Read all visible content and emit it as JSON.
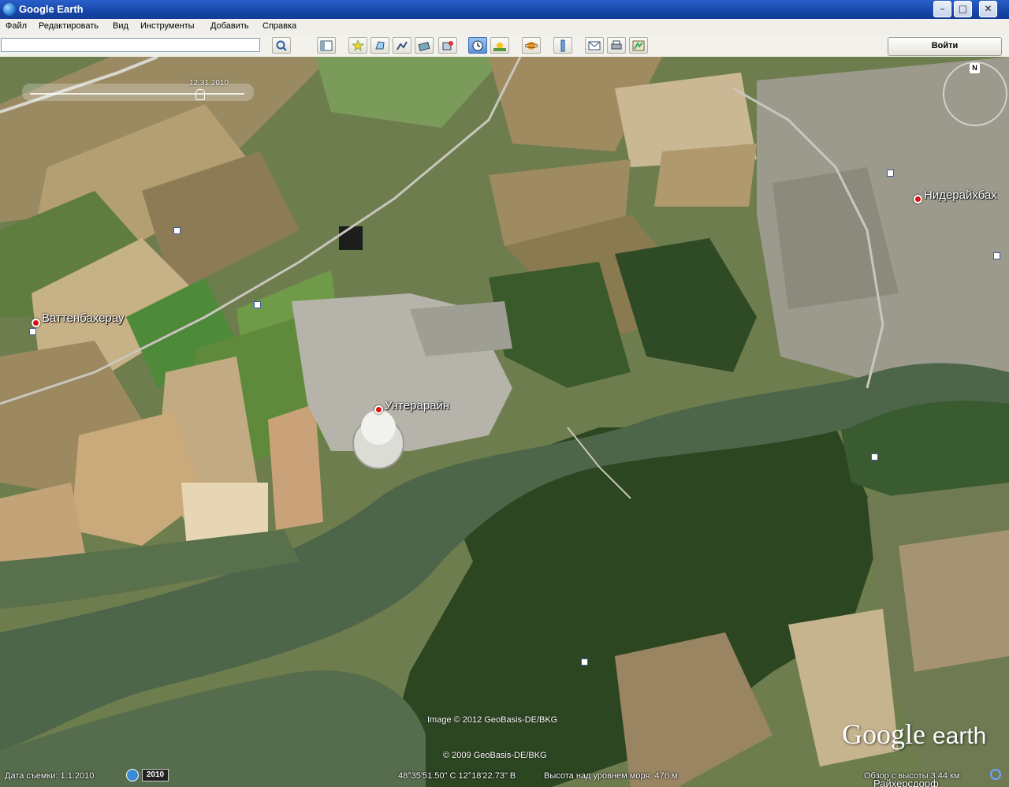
{
  "window": {
    "title": "Google Earth"
  },
  "menu": [
    "Файл",
    "Редактировать",
    "Вид",
    "Инструменты",
    "Добавить",
    "Справка"
  ],
  "search": {
    "value": "",
    "placeholder": ""
  },
  "toolbar": {
    "buttons": [
      "search-icon",
      "sidebar-icon",
      "placemark-icon",
      "polygon-icon",
      "path-icon",
      "overlay-icon",
      "record-tour-icon",
      "historical-imagery-icon",
      "sunlight-icon",
      "planets-icon",
      "ruler-icon",
      "email-icon",
      "print-icon",
      "view-in-maps-icon"
    ],
    "signin_label": "Войти"
  },
  "map": {
    "time_slider_date": "12.31.2010",
    "compass_north": "N",
    "places": [
      {
        "name": "Ваттенбахерау"
      },
      {
        "name": "Унтерарайн"
      },
      {
        "name": "Нидерайхбах"
      }
    ],
    "attribution_1": "Image © 2012 GeoBasis-DE/BKG",
    "attribution_2": "© 2009 GeoBasis-DE/BKG",
    "logo_google": "Google",
    "logo_earth": "earth"
  },
  "status": {
    "imagery_date": "Дата съемки: 1.1.2010",
    "year_badge": "2010",
    "coordinates": "48°35'51.50\" С   12°18'22.73\" В",
    "elevation": "Высота над уровнем моря:   476 м",
    "eye_alt": "Обзор с высоты    3.44 км",
    "bottom_town": "Райхерсдорф"
  },
  "colors": {
    "titlebar": "#1746a8",
    "river": "#4f6a4a",
    "forest": "#2e4a24"
  }
}
